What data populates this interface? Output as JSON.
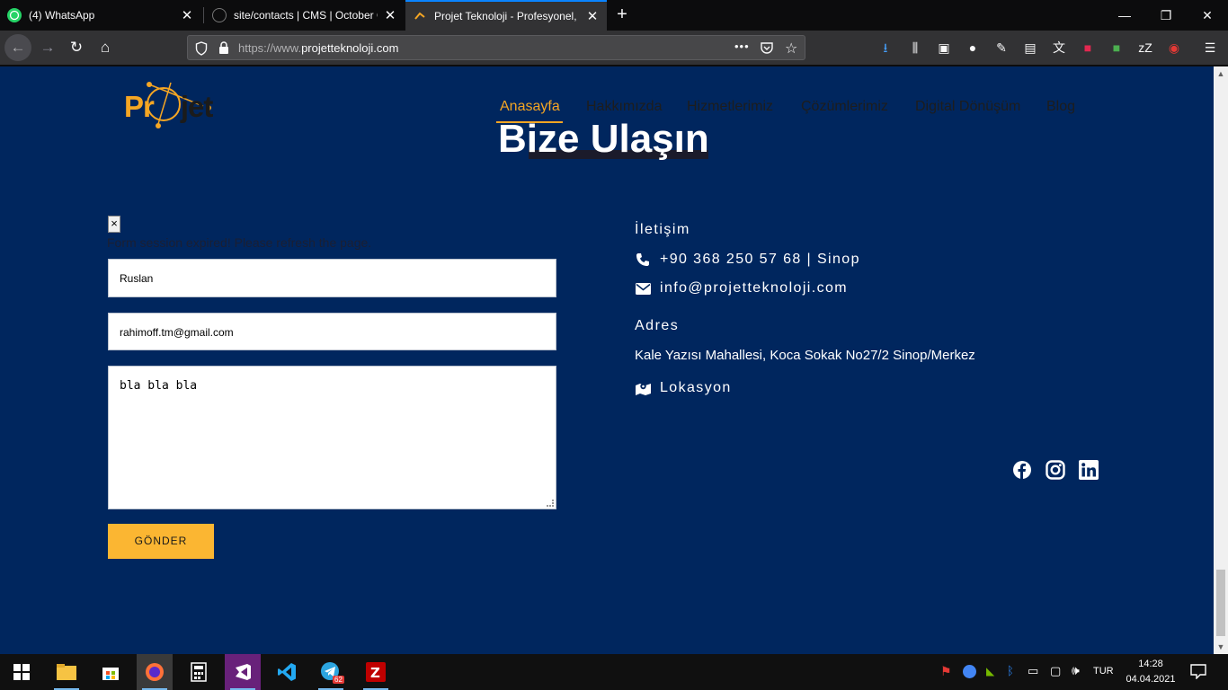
{
  "browser": {
    "tabs": [
      {
        "title": "(4) WhatsApp",
        "icon": "whatsapp-icon"
      },
      {
        "title": "site/contacts | CMS | October C",
        "icon": "october-cms-icon"
      },
      {
        "title": "Projet Teknoloji - Profesyonel, ",
        "icon": "projet-favicon"
      }
    ],
    "url_prefix": "https://www.",
    "url_domain": "projetteknoloji.com",
    "url_more": "•••"
  },
  "site": {
    "logo_part1": "Pr",
    "logo_part2": "jet",
    "menu": [
      "Anasayfa",
      "Hakkımızda",
      "Hizmetlerimiz",
      "Çözümlerimiz",
      "Digital Dönüşüm",
      "Blog"
    ],
    "active_menu": "Anasayfa",
    "page_title": "Bize Ulaşın"
  },
  "form": {
    "close_label": "×",
    "error": "Form session expired! Please refresh the page.",
    "name_value": "Ruslan",
    "email_value": "rahimoff.tm@gmail.com",
    "message_value": "bla bla bla",
    "submit_label": "GÖNDER"
  },
  "contact": {
    "heading": "İletişim",
    "phone": "+90 368 250 57 68 | Sinop",
    "email": "info@projetteknoloji.com",
    "address_heading": "Adres",
    "address": "Kale Yazısı Mahallesi, Koca Sokak No27/2 Sinop/Merkez",
    "location_label": "Lokasyon"
  },
  "social": [
    "facebook-icon",
    "instagram-icon",
    "linkedin-icon"
  ],
  "taskbar": {
    "language": "TUR",
    "time": "14:28",
    "date": "04.04.2021",
    "telegram_badge": "62"
  },
  "colors": {
    "page_bg": "#00265e",
    "accent": "#f5a623",
    "button": "#fbb632",
    "browser_accent": "#0a84ff"
  }
}
